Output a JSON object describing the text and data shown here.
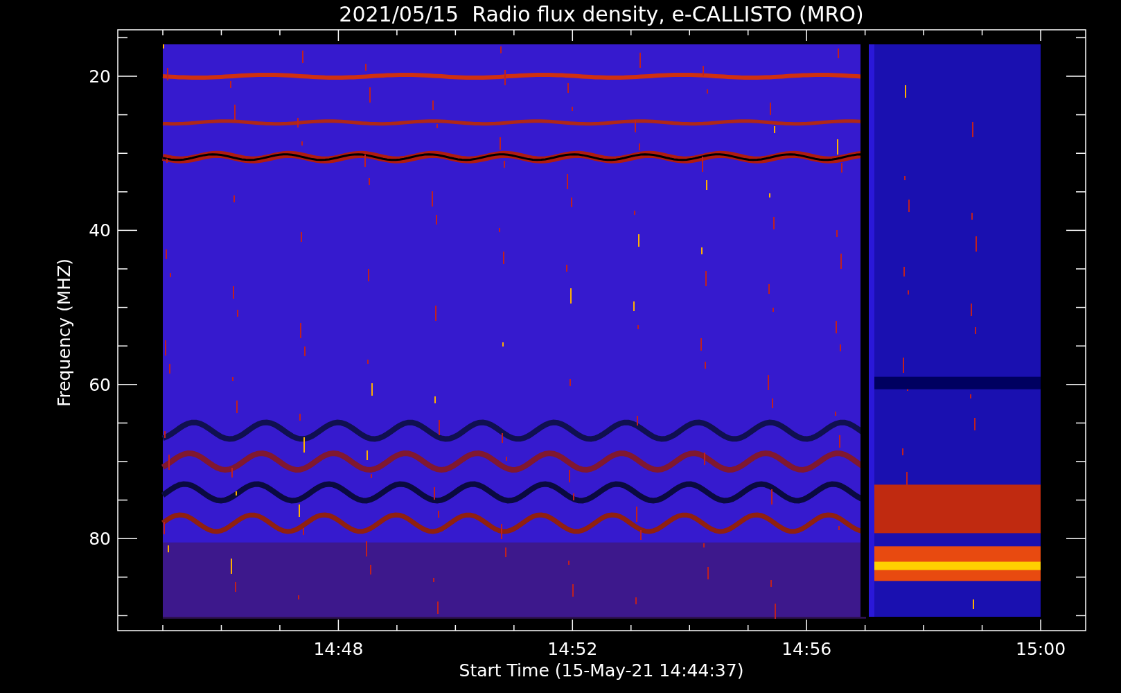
{
  "title": "2021/05/15  Radio flux density, e-CALLISTO (MRO)",
  "y_axis": {
    "label": "Frequency (MHZ)",
    "ticks": [
      "20",
      "40",
      "60",
      "80"
    ]
  },
  "x_axis": {
    "label": "Start Time (15-May-21 14:44:37)",
    "ticks": [
      "14:48",
      "14:52",
      "14:56",
      "15:00"
    ]
  }
}
